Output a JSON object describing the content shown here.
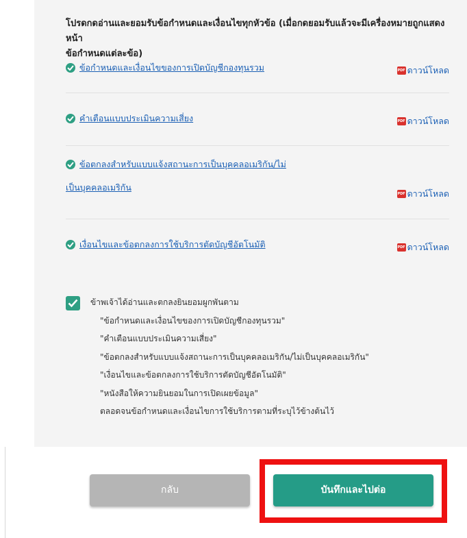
{
  "intro": {
    "line1": "โปรดกดอ่านและยอมรับข้อกำหนดและเงื่อนไขทุกหัวข้อ (เมื่อกดยอมรับแล้วจะมีเครื่องหมายถูกแสดงหน้า",
    "line2": "ข้อกำหนดแต่ละข้อ)"
  },
  "documents": [
    {
      "title": "ข้อกำหนดและเงื่อนไขของการเปิดบัญชีกองทุนรวม",
      "download": "ดาวน์โหลด",
      "icon": "pdf-icon"
    },
    {
      "title": "คำเตือนแบบประเมินความเสี่ยง",
      "download": "ดาวน์โหลด",
      "icon": "pdf-icon"
    },
    {
      "title_line1": "ข้อตกลงสำหรับแบบแจ้งสถานะการเป็นบุคคลอเมริกัน/ไม่",
      "title_line2": "เป็นบุคคลอเมริกัน",
      "download": "ดาวน์โหลด",
      "icon": "pdf-icon"
    },
    {
      "title": "เงื่อนไขและข้อตกลงการใช้บริการตัดบัญชีอัตโนมัติ",
      "download": "ดาวน์โหลด",
      "icon": "pdf-icon"
    }
  ],
  "consent": {
    "checked": true,
    "lines": [
      "ข้าพเจ้าได้อ่านและตกลงยินยอมผูกพันตาม",
      "\"ข้อกำหนดและเงื่อนไขของการเปิดบัญชีกองทุนรวม\"",
      "\"คำเตือนแบบประเมินความเสี่ยง\"",
      "\"ข้อตกลงสำหรับแบบแจ้งสถานะการเป็นบุคคลอเมริกัน/ไม่เป็นบุคคลอเมริกัน\"",
      "\"เงื่อนไขและข้อตกลงการใช้บริการตัดบัญชีอัตโนมัติ\"",
      "\"หนังสือให้ความยินยอมในการเปิดเผยข้อมูล\"",
      "ตลอดจนข้อกำหนดและเงื่อนไขการใช้บริการตามที่ระบุไว้ข้างต้นไว้"
    ]
  },
  "buttons": {
    "back": "กลับ",
    "next": "บันทึกและไปต่อ"
  },
  "colors": {
    "accent": "#259c87",
    "check": "#2e9f83",
    "link": "#1a5fb4",
    "highlight": "#ee1111",
    "disabled": "#b5b5b5"
  }
}
